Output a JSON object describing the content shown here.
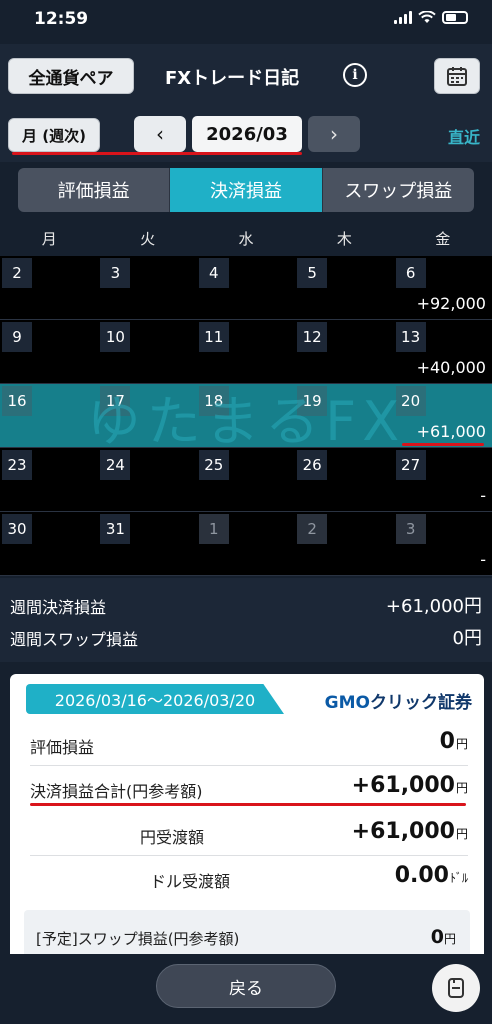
{
  "status": {
    "time": "12:59"
  },
  "header": {
    "currency_button": "全通貨ペア",
    "title": "FXトレード日記",
    "info_icon": "i",
    "calendar_icon": "calendar-icon"
  },
  "nav": {
    "view_button": "月 (週次)",
    "prev": "‹",
    "month": "2026/03",
    "next": "›",
    "recent": "直近"
  },
  "tabs": [
    {
      "label": "評価損益",
      "active": false
    },
    {
      "label": "決済損益",
      "active": true
    },
    {
      "label": "スワップ損益",
      "active": false
    }
  ],
  "weekdays": [
    "月",
    "火",
    "水",
    "木",
    "金"
  ],
  "calendar": {
    "weeks": [
      {
        "days": [
          "2",
          "3",
          "4",
          "5",
          "6"
        ],
        "value": "+92,000",
        "highlighted": false
      },
      {
        "days": [
          "9",
          "10",
          "11",
          "12",
          "13"
        ],
        "value": "+40,000",
        "highlighted": false
      },
      {
        "days": [
          "16",
          "17",
          "18",
          "19",
          "20"
        ],
        "value": "+61,000",
        "highlighted": true
      },
      {
        "days": [
          "23",
          "24",
          "25",
          "26",
          "27"
        ],
        "value": "-",
        "highlighted": false
      },
      {
        "days": [
          "30",
          "31",
          "1",
          "2",
          "3"
        ],
        "value": "-",
        "highlighted": false
      }
    ]
  },
  "watermark": "ゆたまるFX",
  "summary": {
    "weekly_settled_label": "週間決済損益",
    "weekly_settled_value": "+61,000円",
    "weekly_swap_label": "週間スワップ損益",
    "weekly_swap_value": "0円"
  },
  "card": {
    "date_range": "2026/03/16～2026/03/20",
    "logo_prefix": "GMO",
    "logo_suffix": "クリック証券",
    "rows": [
      {
        "label": "評価損益",
        "value": "0",
        "unit": "円"
      },
      {
        "label": "決済損益合計(円参考額)",
        "value": "+61,000",
        "unit": "円"
      },
      {
        "label": "円受渡額",
        "value": "+61,000",
        "unit": "円"
      },
      {
        "label": "ドル受渡額",
        "value": "0.00",
        "unit": "ﾄﾞﾙ"
      }
    ],
    "scheduled_label": "[予定]スワップ損益(円参考額)",
    "scheduled_value": "0",
    "scheduled_unit": "円"
  },
  "bottom": {
    "back": "戻る"
  },
  "colors": {
    "accent": "#1fb0c7",
    "highlight_row": "#167f8b",
    "annotation_red": "#d9141b"
  }
}
